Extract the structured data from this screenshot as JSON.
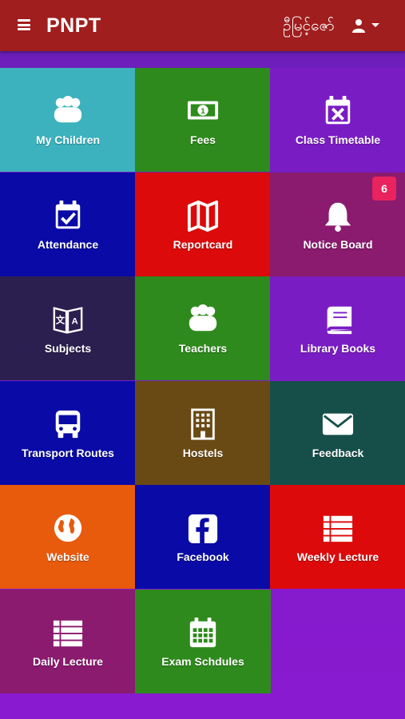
{
  "header": {
    "title": "PNPT",
    "language": "ဦမြင့်ဇော်",
    "menu_icon": "hamburger-icon",
    "user_icon": "user-icon"
  },
  "colors": {
    "header_bg": "#a01e1e",
    "page_bg": "#7a1cc4",
    "badge_bg": "#e8235e"
  },
  "tiles": [
    {
      "label": "My Children",
      "icon": "children-icon",
      "color": "#3bb2bd"
    },
    {
      "label": "Fees",
      "icon": "money-icon",
      "color": "#2e8a1c"
    },
    {
      "label": "Class Timetable",
      "icon": "calendar-x-icon",
      "color": "#7a1cc4"
    },
    {
      "label": "Attendance",
      "icon": "calendar-check-icon",
      "color": "#0a0aa6"
    },
    {
      "label": "Reportcard",
      "icon": "map-icon",
      "color": "#dc0a0a"
    },
    {
      "label": "Notice Board",
      "icon": "bell-icon",
      "color": "#8a1b6e",
      "badge": "6"
    },
    {
      "label": "Subjects",
      "icon": "language-book-icon",
      "color": "#2b1f4f"
    },
    {
      "label": "Teachers",
      "icon": "teachers-icon",
      "color": "#2e8a1c"
    },
    {
      "label": "Library Books",
      "icon": "book-icon",
      "color": "#7a1cc4"
    },
    {
      "label": "Transport Routes",
      "icon": "bus-icon",
      "color": "#0a0aa6"
    },
    {
      "label": "Hostels",
      "icon": "building-icon",
      "color": "#6a4a14"
    },
    {
      "label": "Feedback",
      "icon": "envelope-icon",
      "color": "#164f4a"
    },
    {
      "label": "Website",
      "icon": "globe-icon",
      "color": "#e85a0c"
    },
    {
      "label": "Facebook",
      "icon": "facebook-icon",
      "color": "#0a0aa6"
    },
    {
      "label": "Weekly Lecture",
      "icon": "list-icon",
      "color": "#dc0a0a"
    },
    {
      "label": "Daily Lecture",
      "icon": "list-icon",
      "color": "#8a1b6e"
    },
    {
      "label": "Exam Schdules",
      "icon": "calendar-grid-icon",
      "color": "#2e8a1c"
    }
  ]
}
